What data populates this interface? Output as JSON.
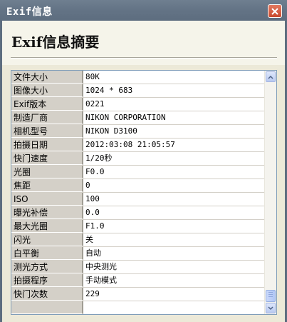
{
  "window": {
    "title": "Exif信息"
  },
  "header": {
    "heading": "Exif信息摘要"
  },
  "exif": {
    "rows": [
      {
        "label": "文件大小",
        "value": "80K"
      },
      {
        "label": "图像大小",
        "value": "1024 * 683"
      },
      {
        "label": "Exif版本",
        "value": "0221"
      },
      {
        "label": "制造厂商",
        "value": "NIKON CORPORATION"
      },
      {
        "label": "相机型号",
        "value": "NIKON D3100"
      },
      {
        "label": "拍摄日期",
        "value": "2012:03:08 21:05:57"
      },
      {
        "label": "快门速度",
        "value": "1/20秒"
      },
      {
        "label": "光圈",
        "value": "F0.0"
      },
      {
        "label": "焦距",
        "value": "0"
      },
      {
        "label": "ISO",
        "value": "100"
      },
      {
        "label": "曝光补偿",
        "value": "0.0"
      },
      {
        "label": "最大光圈",
        "value": "F1.0"
      },
      {
        "label": "闪光",
        "value": "关"
      },
      {
        "label": "白平衡",
        "value": "自动"
      },
      {
        "label": "测光方式",
        "value": "中央测光"
      },
      {
        "label": "拍摄程序",
        "value": "手动模式"
      },
      {
        "label": "快门次数",
        "value": "229"
      },
      {
        "label": "",
        "value": ""
      }
    ]
  },
  "icons": {
    "close": "close-icon",
    "up": "arrow-up-icon",
    "down": "arrow-down-icon"
  }
}
